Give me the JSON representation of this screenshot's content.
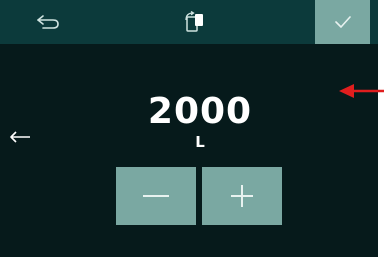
{
  "toolbar": {
    "back_icon": "undo-arrow-icon",
    "rotate_icon": "rotate-screen-icon",
    "confirm_icon": "checkmark-icon"
  },
  "main": {
    "value": "2000",
    "unit": "L",
    "side_icon": "left-arrow-icon",
    "minus_icon": "minus-icon",
    "plus_icon": "plus-icon"
  },
  "colors": {
    "background": "#061a1b",
    "topbar": "#0c3a3b",
    "button": "#7aa8a2",
    "annotation": "#e01e1e"
  }
}
